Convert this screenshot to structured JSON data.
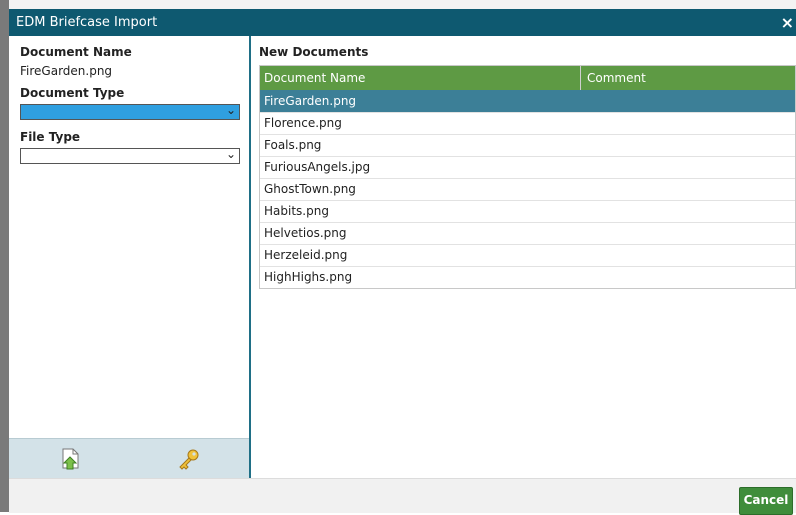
{
  "window": {
    "title": "EDM Briefcase Import",
    "close_glyph": "×"
  },
  "left_panel": {
    "document_name_label": "Document Name",
    "document_name_value": "FireGarden.png",
    "document_type_label": "Document Type",
    "document_type_value": "",
    "file_type_label": "File Type",
    "file_type_value": "",
    "chevron": "⌄",
    "toolbar": [
      {
        "icon": "upload-document-icon"
      },
      {
        "icon": "key-icon"
      }
    ]
  },
  "right_panel": {
    "section_title": "New Documents",
    "columns": [
      "Document Name",
      "Comment"
    ],
    "rows": [
      {
        "name": "FireGarden.png",
        "comment": "",
        "selected": true
      },
      {
        "name": "Florence.png",
        "comment": ""
      },
      {
        "name": "Foals.png",
        "comment": ""
      },
      {
        "name": "FuriousAngels.jpg",
        "comment": ""
      },
      {
        "name": "GhostTown.png",
        "comment": ""
      },
      {
        "name": "Habits.png",
        "comment": ""
      },
      {
        "name": "Helvetios.png",
        "comment": ""
      },
      {
        "name": "Herzeleid.png",
        "comment": ""
      },
      {
        "name": "HighHighs.png",
        "comment": ""
      }
    ]
  },
  "footer": {
    "cancel_label": "Cancel"
  },
  "colors": {
    "titlebar": "#0e5970",
    "table_header": "#5e9a44",
    "selected_row": "#3c7f97",
    "select_filled": "#2f9fe0",
    "cancel_button": "#3f8d3b"
  }
}
